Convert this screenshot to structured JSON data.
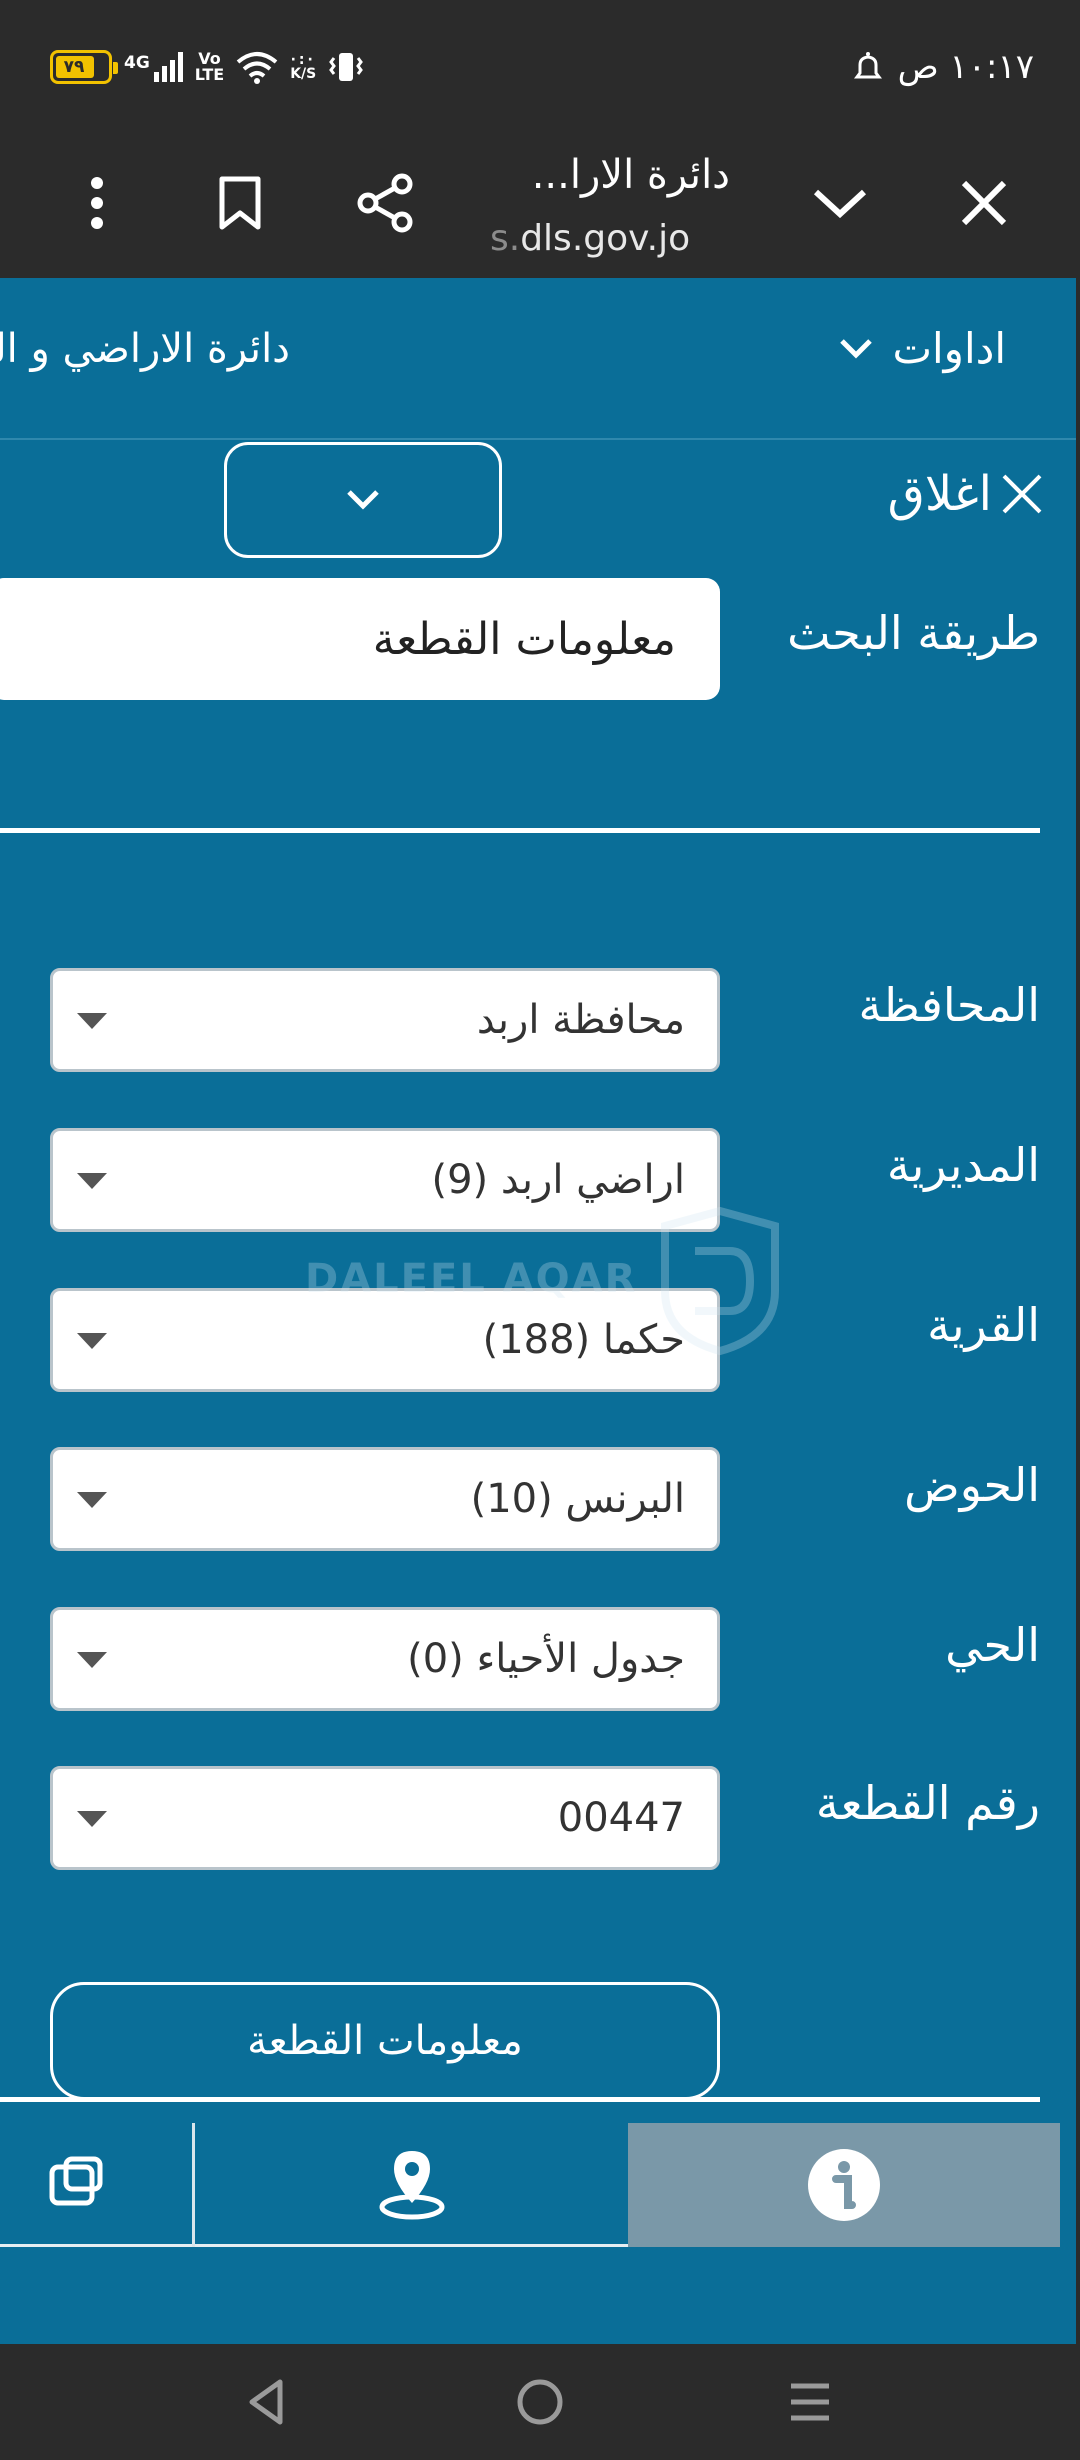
{
  "status_bar": {
    "battery_level": "٧٩",
    "network_type": "4G",
    "volte_line1": "Vo",
    "volte_line2": "LTE",
    "speed_unit": "K/S",
    "clock": "١٠:١٧ ص"
  },
  "browser": {
    "tab_title": "دائرة الارا...",
    "url_prefix": "s.",
    "url_domain": "dls.gov.jo"
  },
  "nav": {
    "tools_label": "اداوات",
    "brand_text": "دائرة الاراضي و المساحة"
  },
  "panel": {
    "close_label": "اغلاق",
    "search_method_label": "طريقة البحث",
    "search_method_value": "معلومات القطعة"
  },
  "form": {
    "fields": [
      {
        "label": "المحافظة",
        "value": "محافظة اربد"
      },
      {
        "label": "المديرية",
        "value": "اراضي اربد (9)"
      },
      {
        "label": "القرية",
        "value": "حكما (188)"
      },
      {
        "label": "الحوض",
        "value": "البرنس (10)"
      },
      {
        "label": "الحي",
        "value": "جدول الأحياء (0)"
      },
      {
        "label": "رقم القطعة",
        "value": "00447"
      }
    ],
    "submit_label": "معلومات القطعة"
  },
  "watermark": {
    "text": "DALEEL AQAR"
  },
  "colors": {
    "page_bg": "#0a6e98",
    "chrome_bg": "#2b2b2b",
    "active_tab": "#7a98a8",
    "battery": "#f2c200"
  },
  "icons": {
    "bottom_tabs": [
      "info-icon",
      "map-pin-icon",
      "layers-icon"
    ],
    "system_nav": [
      "back-icon",
      "home-icon",
      "menu-icon"
    ]
  }
}
